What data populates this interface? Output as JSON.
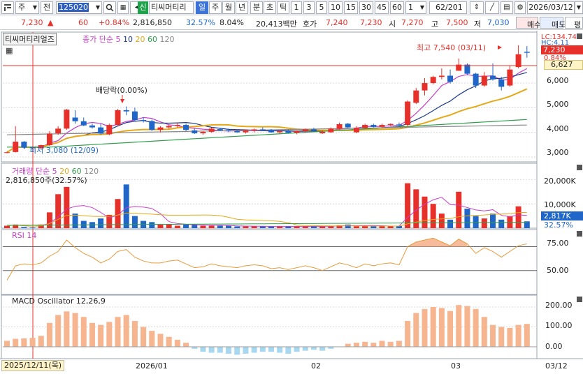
{
  "toolbar": {
    "menu_icon": "menu-icon",
    "type_label": "주",
    "all_label": "전",
    "code": "125020",
    "search_icon": "search-icon",
    "grid_icon": "grid-icon",
    "sound_icon": "speaker-icon",
    "dropdown_icon": "chevron-down-icon",
    "new_badge": "신",
    "stock_name": "티씨머티리",
    "periods": [
      "일",
      "주",
      "월",
      "년",
      "분",
      "초",
      "틱"
    ],
    "active_period": "일",
    "intervals": [
      "1",
      "3",
      "5",
      "10",
      "15",
      "30",
      "45",
      "60"
    ],
    "interval_value": "1",
    "page_value": "62",
    "page_total": "/201",
    "date": "2026/03/12"
  },
  "quote": {
    "price": "7,230",
    "arrow": "▲",
    "change": "60",
    "change_pct": "+0.84%",
    "volume": "2,816,850",
    "vol_ratio": "32.57%",
    "turnover": "8.04%",
    "amount": "20,413백만",
    "ask_label": "호가",
    "ask": "7,240",
    "bid": "7,230",
    "open_label": "시",
    "open": "7,270",
    "high_label": "고",
    "high": "7,500",
    "low_label": "저",
    "low": "7,030",
    "buy": "매수",
    "sell": "매도",
    "eval": "평"
  },
  "price_panel": {
    "title": "티씨머티리얼즈",
    "ma_title": "종가 단순",
    "ma_periods": [
      "5",
      "10",
      "20",
      "60",
      "120"
    ],
    "lc": "LC:134.74",
    "hc": "HC:4.11",
    "current_tag": "7,230",
    "pct_tag": "0.84%",
    "ref_tag": "6,627",
    "high_note": "최고 7,540 (03/11)",
    "low_note": "최저 3,080 (12/09)",
    "dividend_note": "배당락(0.00%)",
    "y_ticks": [
      "6,000",
      "5,000",
      "4,000",
      "3,000"
    ]
  },
  "volume_panel": {
    "title": "거래량",
    "ma_title": "단순",
    "ma_periods": [
      "5",
      "20",
      "60",
      "120"
    ],
    "summary": "2,816,850주(32.57%)",
    "y_ticks": [
      "20,000K",
      "10,000K"
    ],
    "value_tag": "2,817K",
    "pct_tag": "32.57%"
  },
  "rsi_panel": {
    "title": "RSI 14",
    "y_ticks": [
      "75.00",
      "50.00"
    ]
  },
  "macd_panel": {
    "title": "MACD Oscillator 12,26,9",
    "y_ticks": [
      "200.00",
      "100.00",
      "0.00"
    ]
  },
  "x_axis": {
    "cursor_date": "2025/12/11(목)",
    "ticks": [
      "2026/01",
      "02",
      "03"
    ],
    "end": "03/12"
  },
  "colors": {
    "up": "#e8302a",
    "down": "#1f66c8",
    "ma5": "#c83cc8",
    "ma10": "#1a3a8a",
    "ma20": "#e6a817",
    "ma60": "#2e9e4a",
    "ma120": "#888888",
    "osc": "#f6b48f",
    "osc_neg": "#a8d8ef"
  },
  "chart_data": {
    "type": "candlestick",
    "price_range": [
      2800,
      7900
    ],
    "candles": [
      [
        3180,
        3220,
        3150,
        3190
      ],
      [
        3200,
        4250,
        3180,
        3620
      ],
      [
        3620,
        3650,
        3330,
        3380
      ],
      [
        3380,
        3420,
        3300,
        3360
      ],
      [
        3350,
        3500,
        3340,
        3480
      ],
      [
        3480,
        4050,
        3450,
        3950
      ],
      [
        3960,
        4250,
        3900,
        4150
      ],
      [
        4150,
        4950,
        4100,
        4920
      ],
      [
        4600,
        4900,
        4350,
        4450
      ],
      [
        4450,
        4600,
        4250,
        4280
      ],
      [
        4280,
        4350,
        4150,
        4200
      ],
      [
        4200,
        4350,
        3900,
        3950
      ],
      [
        3920,
        4350,
        3880,
        4300
      ],
      [
        4300,
        4950,
        4250,
        4900
      ],
      [
        4900,
        5050,
        4700,
        4850
      ],
      [
        4850,
        5000,
        4450,
        4500
      ],
      [
        4500,
        4600,
        4400,
        4470
      ],
      [
        4460,
        4520,
        4050,
        4100
      ],
      [
        4100,
        4250,
        4000,
        4200
      ],
      [
        4200,
        4300,
        4150,
        4260
      ],
      [
        4260,
        4400,
        4200,
        4300
      ],
      [
        4300,
        4350,
        4050,
        4100
      ],
      [
        4080,
        4150,
        3930,
        3960
      ],
      [
        3960,
        4050,
        3900,
        4020
      ],
      [
        4020,
        4200,
        3980,
        4150
      ],
      [
        4130,
        4160,
        4050,
        4080
      ],
      [
        4080,
        4150,
        4000,
        4050
      ],
      [
        4050,
        4120,
        3980,
        4000
      ],
      [
        4000,
        4100,
        3950,
        4080
      ],
      [
        4080,
        4150,
        4000,
        4120
      ],
      [
        4120,
        4200,
        4050,
        4100
      ],
      [
        4100,
        4130,
        3980,
        4000
      ],
      [
        4000,
        4080,
        3950,
        4050
      ],
      [
        4050,
        4100,
        3950,
        3980
      ],
      [
        3980,
        4080,
        3920,
        4050
      ],
      [
        4050,
        4150,
        4000,
        4120
      ],
      [
        4120,
        4180,
        4030,
        4060
      ],
      [
        3960,
        4080,
        3930,
        4020
      ],
      [
        4000,
        4200,
        3980,
        4150
      ],
      [
        4150,
        4400,
        4100,
        4330
      ],
      [
        4350,
        4380,
        4180,
        4200
      ],
      [
        4000,
        4250,
        3960,
        4180
      ],
      [
        4180,
        4350,
        4150,
        4300
      ],
      [
        4300,
        4350,
        4200,
        4220
      ],
      [
        4220,
        4350,
        4180,
        4300
      ],
      [
        4300,
        4360,
        4250,
        4340
      ],
      [
        4320,
        4400,
        4250,
        4280
      ],
      [
        4300,
        5300,
        4250,
        5250
      ],
      [
        5200,
        5800,
        5150,
        5700
      ],
      [
        5700,
        6200,
        5500,
        6000
      ],
      [
        6000,
        6300,
        5950,
        6250
      ],
      [
        6250,
        6600,
        6150,
        6300
      ],
      [
        6300,
        6550,
        5980,
        6050
      ],
      [
        6500,
        7000,
        6500,
        6750
      ],
      [
        6750,
        6800,
        6320,
        6380
      ],
      [
        6380,
        6420,
        5800,
        5900
      ],
      [
        5900,
        6450,
        5850,
        6300
      ],
      [
        6300,
        6800,
        6100,
        6150
      ],
      [
        6150,
        6250,
        5700,
        5850
      ],
      [
        5900,
        6700,
        5850,
        6550
      ],
      [
        6650,
        7540,
        6600,
        7170
      ],
      [
        7270,
        7500,
        7030,
        7230
      ]
    ],
    "volume": [
      1.0,
      1.5,
      0.5,
      0.3,
      1.5,
      6.5,
      14.0,
      17.0,
      6.0,
      3.0,
      2.5,
      4.0,
      5.5,
      12.0,
      18.0,
      5.0,
      3.0,
      2.5,
      1.5,
      1.5,
      1.0,
      1.5,
      1.5,
      1.0,
      1.0,
      1.0,
      1.0,
      0.7,
      0.7,
      0.8,
      0.8,
      0.8,
      0.7,
      0.7,
      0.7,
      0.8,
      0.8,
      0.7,
      1.0,
      1.2,
      1.5,
      0.8,
      1.0,
      0.9,
      0.9,
      0.8,
      0.9,
      18.5,
      16.0,
      13.0,
      10.0,
      6.0,
      3.5,
      15.0,
      8.0,
      5.0,
      4.0,
      6.0,
      3.5,
      5.0,
      9.0,
      2.8
    ],
    "rsi": [
      40,
      55,
      57,
      56,
      58,
      65,
      70,
      82,
      74,
      68,
      64,
      58,
      62,
      70,
      72,
      64,
      60,
      58,
      58,
      60,
      61,
      57,
      53,
      54,
      57,
      55,
      54,
      53,
      55,
      56,
      55,
      52,
      53,
      51,
      53,
      55,
      53,
      50,
      54,
      58,
      56,
      53,
      57,
      55,
      57,
      58,
      56,
      75,
      80,
      82,
      84,
      80,
      76,
      83,
      78,
      68,
      74,
      70,
      64,
      70,
      76,
      78
    ],
    "macd": [
      30,
      40,
      42,
      45,
      55,
      120,
      160,
      178,
      170,
      150,
      120,
      110,
      125,
      150,
      160,
      130,
      100,
      80,
      65,
      50,
      35,
      20,
      -10,
      -25,
      -30,
      -30,
      -35,
      -40,
      -35,
      -30,
      -25,
      -25,
      -30,
      -35,
      -25,
      -20,
      -15,
      -20,
      -10,
      0,
      15,
      20,
      25,
      20,
      30,
      25,
      30,
      130,
      170,
      190,
      200,
      195,
      180,
      210,
      205,
      190,
      150,
      110,
      100,
      95,
      110,
      115
    ]
  }
}
